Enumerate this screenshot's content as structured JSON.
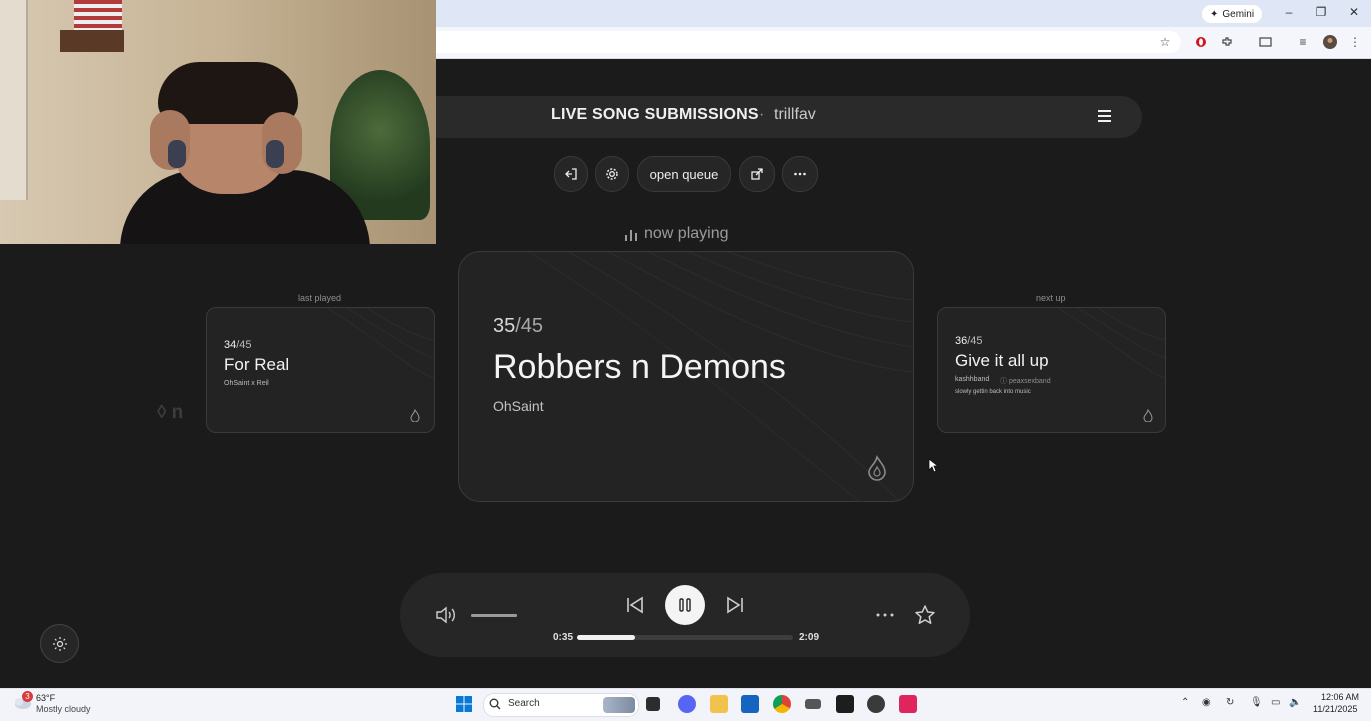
{
  "browser": {
    "gemini_label": "Gemini",
    "window_controls": [
      "–",
      "❐",
      "✕"
    ]
  },
  "header": {
    "title": "LIVE SONG SUBMISSIONS",
    "separator": "·",
    "username": "trillfav"
  },
  "controls": {
    "open_queue_label": "open queue"
  },
  "now_playing_label": "now playing",
  "last_played": {
    "label": "last played",
    "position": "34",
    "total": "/45",
    "title": "For Real",
    "artist": "OhSaint x Reil"
  },
  "current": {
    "position": "35",
    "total": "/45",
    "title": "Robbers n Demons",
    "artist": "OhSaint"
  },
  "next_up": {
    "label": "next up",
    "position": "36",
    "total": "/45",
    "title": "Give it all up",
    "artist": "kashhband",
    "handle": "ⓘ peaxsexband",
    "note": "slowly gettin back into music"
  },
  "player": {
    "elapsed": "0:35",
    "duration": "2:09",
    "progress_fraction": 0.27,
    "volume_fraction": 1.0
  },
  "taskbar": {
    "temp": "63°F",
    "weather": "Mostly cloudy",
    "weather_badge": "3",
    "search_label": "Search",
    "time": "12:06 AM",
    "date": "11/21/2025"
  },
  "colors": {
    "background": "#1b1b1c",
    "card": "#232324",
    "accent_white": "#f4f4f4"
  }
}
